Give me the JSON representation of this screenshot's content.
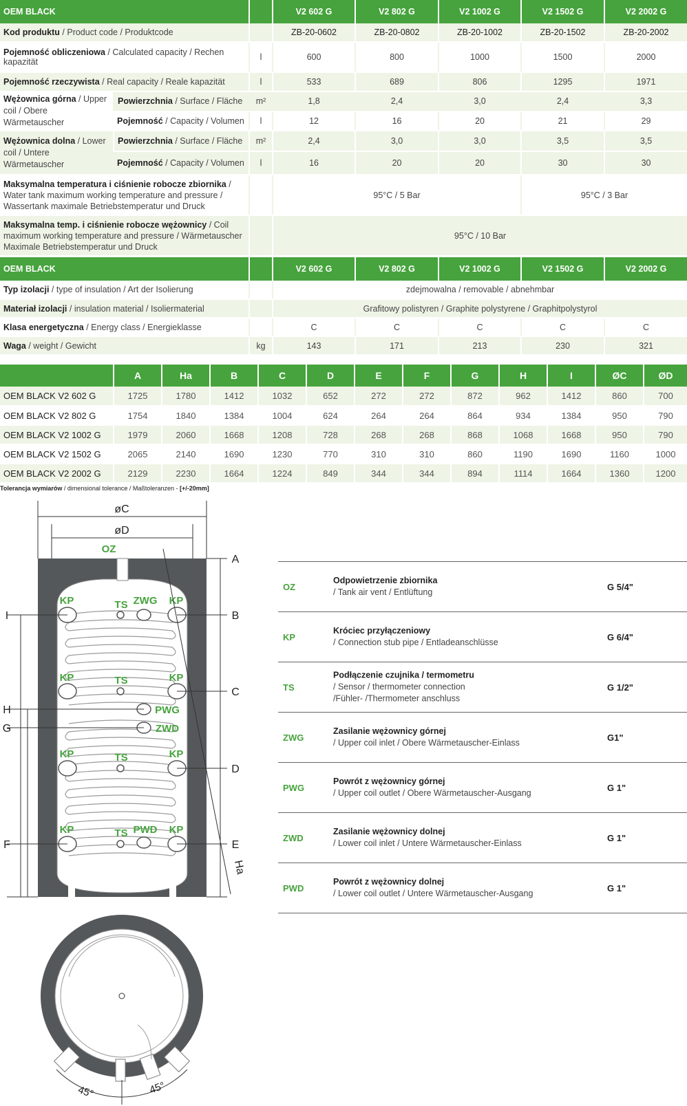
{
  "spec1": {
    "header": [
      "OEM BLACK",
      "V2 602 G",
      "V2 802 G",
      "V2 1002 G",
      "V2 1502 G",
      "V2 2002 G"
    ],
    "product_code": {
      "pl": "Kod produktu",
      "rest": " / Product code / Produktcode",
      "values": [
        "ZB-20-0602",
        "ZB-20-0802",
        "ZB-20-1002",
        "ZB-20-1502",
        "ZB-20-2002"
      ]
    },
    "calc_capacity": {
      "pl": "Pojemność obliczeniowa",
      "rest": " / Calculated capacity / Rechen kapazität",
      "unit": "l",
      "values": [
        "600",
        "800",
        "1000",
        "1500",
        "2000"
      ]
    },
    "real_capacity": {
      "pl": "Pojemność rzeczywista",
      "rest": " / Real capacity / Reale kapazität",
      "unit": "l",
      "values": [
        "533",
        "689",
        "806",
        "1295",
        "1971"
      ]
    },
    "upper_coil": {
      "pl": "Wężownica górna",
      "rest": " / Upper coil / Obere Wärmetauscher"
    },
    "lower_coil": {
      "pl": "Wężownica dolna",
      "rest": " / Lower coil / Untere Wärmetauscher"
    },
    "surface": {
      "pl": "Powierzchnia",
      "rest": " / Surface / Fläche",
      "unit": "m²"
    },
    "capacity": {
      "pl": "Pojemność",
      "rest": " / Capacity / Volumen",
      "unit": "l"
    },
    "upper_surface": [
      "1,8",
      "2,4",
      "3,0",
      "2,4",
      "3,3"
    ],
    "upper_capacity": [
      "12",
      "16",
      "20",
      "21",
      "29"
    ],
    "lower_surface": [
      "2,4",
      "3,0",
      "3,0",
      "3,5",
      "3,5"
    ],
    "lower_capacity": [
      "16",
      "20",
      "20",
      "30",
      "30"
    ],
    "tank_max": {
      "pl": "Maksymalna temperatura i ciśnienie robocze zbiornika",
      "rest": " / Water tank maximum working temperature and pressure / Wassertank maximale Betriebstemperatur und Druck",
      "v1": "95°C / 5 Bar",
      "v2": "95°C / 3 Bar"
    },
    "coil_max": {
      "pl": "Maksymalna temp. i ciśnienie robocze wężownicy",
      "rest": " / Coil maximum working temperature and pressure / Wärmetauscher Maximale Betriebstemperatur und Druck",
      "v": "95°C / 10 Bar"
    }
  },
  "spec2": {
    "header": [
      "OEM BLACK",
      "V2 602 G",
      "V2 802 G",
      "V2 1002 G",
      "V2 1502 G",
      "V2 2002 G"
    ],
    "insulation_type": {
      "pl": "Typ izolacji",
      "rest": " / type of insulation / Art der Isolierung",
      "v": "zdejmowalna / removable / abnehmbar"
    },
    "insulation_material": {
      "pl": "Materiał izolacji",
      "rest": " / insulation material / Isoliermaterial",
      "v": "Grafitowy polistyren / Graphite polystyrene / Graphitpolystyrol"
    },
    "energy_class": {
      "pl": "Klasa energetyczna",
      "rest": " / Energy class / Energieklasse",
      "values": [
        "C",
        "C",
        "C",
        "C",
        "C"
      ]
    },
    "weight": {
      "pl": "Waga",
      "rest": " / weight / Gewicht",
      "unit": "kg",
      "values": [
        "143",
        "171",
        "213",
        "230",
        "321"
      ]
    }
  },
  "dims": {
    "header": [
      "",
      "A",
      "Ha",
      "B",
      "C",
      "D",
      "E",
      "F",
      "G",
      "H",
      "I",
      "ØC",
      "ØD"
    ],
    "rows": [
      [
        "OEM BLACK V2 602 G",
        "1725",
        "1780",
        "1412",
        "1032",
        "652",
        "272",
        "272",
        "872",
        "962",
        "1412",
        "860",
        "700"
      ],
      [
        "OEM BLACK V2 802 G",
        "1754",
        "1840",
        "1384",
        "1004",
        "624",
        "264",
        "264",
        "864",
        "934",
        "1384",
        "950",
        "790"
      ],
      [
        "OEM BLACK V2 1002 G",
        "1979",
        "2060",
        "1668",
        "1208",
        "728",
        "268",
        "268",
        "868",
        "1068",
        "1668",
        "950",
        "790"
      ],
      [
        "OEM BLACK V2 1502 G",
        "2065",
        "2140",
        "1690",
        "1230",
        "770",
        "310",
        "310",
        "860",
        "1190",
        "1690",
        "1160",
        "1000"
      ],
      [
        "OEM BLACK V2 2002 G",
        "2129",
        "2230",
        "1664",
        "1224",
        "849",
        "344",
        "344",
        "894",
        "1114",
        "1664",
        "1360",
        "1200"
      ]
    ]
  },
  "tolerance": {
    "bold": "Tolerancja wymiarów",
    "rest": " / dimensional tolerance / Maßtoleranzen - ",
    "bold2": "[+/-20mm]"
  },
  "diagram": {
    "oc": "øC",
    "od": "øD",
    "oz": "OZ",
    "right_letters": [
      "A",
      "B",
      "C",
      "D",
      "E"
    ],
    "left_letters": [
      "I",
      "H",
      "G",
      "F"
    ],
    "ha": "Ha",
    "kp": "KP",
    "ts": "TS",
    "zwg": "ZWG",
    "pwg": "PWG",
    "zwd": "ZWD",
    "pwd": "PWD",
    "angle": "45°"
  },
  "legend": [
    {
      "code": "OZ",
      "t1": "Odpowietrzenie zbiornika",
      "t2": "/ Tank air vent / Entlüftung",
      "t3": "",
      "size": "G 5/4\""
    },
    {
      "code": "KP",
      "t1": "Króciec przyłączeniowy",
      "t2": "/ Connection stub pipe / Entladeanschlüsse",
      "t3": "",
      "size": "G 6/4\""
    },
    {
      "code": "TS",
      "t1": "Podłączenie czujnika / termometru",
      "t2": "/ Sensor / thermometer connection",
      "t3": "/Fühler- /Thermometer anschluss",
      "size": "G 1/2\""
    },
    {
      "code": "ZWG",
      "t1": "Zasilanie wężownicy górnej",
      "t2": "/ Upper coil inlet / Obere Wärmetauscher-Einlass",
      "t3": "",
      "size": "G1\""
    },
    {
      "code": "PWG",
      "t1": "Powrót z wężownicy górnej",
      "t2": "/ Upper coil outlet / Obere Wärmetauscher-Ausgang",
      "t3": "",
      "size": "G 1\""
    },
    {
      "code": "ZWD",
      "t1": "Zasilanie wężownicy dolnej",
      "t2": "/ Lower coil inlet / Untere Wärmetauscher-Einlass",
      "t3": "",
      "size": "G 1\""
    },
    {
      "code": "PWD",
      "t1": "Powrót z wężownicy dolnej",
      "t2": "/ Lower coil outlet / Untere Wärmetauscher-Ausgang",
      "t3": "",
      "size": "G 1\""
    }
  ],
  "colors": {
    "green": "#46a33d",
    "light": "#eef4e6",
    "insulation": "#55585a"
  }
}
